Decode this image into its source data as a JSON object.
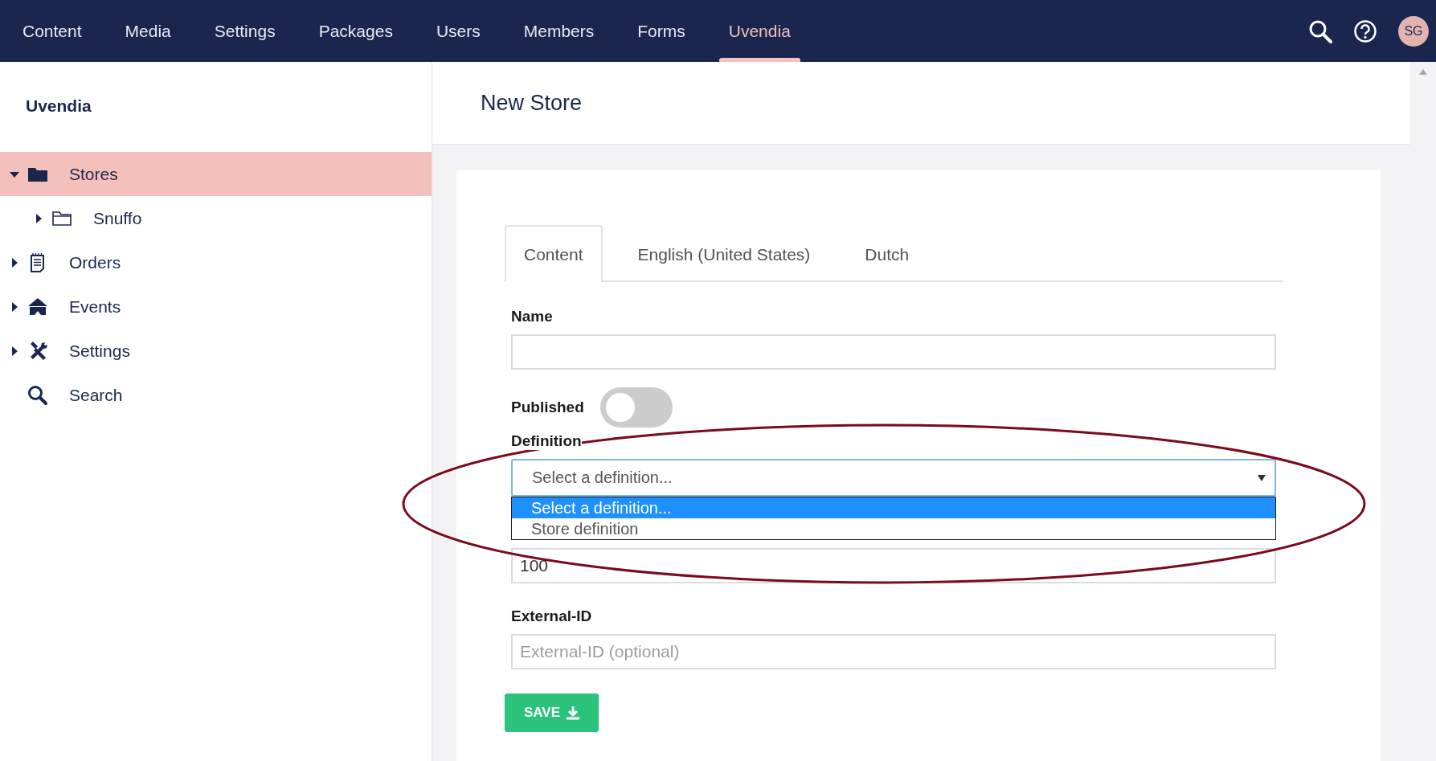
{
  "top_nav": {
    "items": [
      {
        "label": "Content",
        "selected": false
      },
      {
        "label": "Media",
        "selected": false
      },
      {
        "label": "Settings",
        "selected": false
      },
      {
        "label": "Packages",
        "selected": false
      },
      {
        "label": "Users",
        "selected": false
      },
      {
        "label": "Members",
        "selected": false
      },
      {
        "label": "Forms",
        "selected": false
      },
      {
        "label": "Uvendia",
        "selected": true
      }
    ],
    "avatar": "SG"
  },
  "sidebar": {
    "title": "Uvendia",
    "items": [
      {
        "label": "Stores",
        "selected": true,
        "expandable": true,
        "expanded": true,
        "children": [
          {
            "label": "Snuffo",
            "selected": false,
            "expandable": true,
            "expanded": false
          }
        ]
      },
      {
        "label": "Orders",
        "selected": false,
        "expandable": true,
        "expanded": false
      },
      {
        "label": "Events",
        "selected": false,
        "expandable": true,
        "expanded": false
      },
      {
        "label": "Settings",
        "selected": false,
        "expandable": true,
        "expanded": false
      },
      {
        "label": "Search",
        "selected": false,
        "expandable": false
      }
    ]
  },
  "editor": {
    "title": "New Store",
    "tabs": [
      {
        "label": "Content",
        "selected": true
      },
      {
        "label": "English (United States)",
        "selected": false
      },
      {
        "label": "Dutch",
        "selected": false
      }
    ],
    "fields": [
      {
        "kind": "text",
        "label": "Name"
      },
      {
        "kind": "toggle",
        "label": "Published",
        "on": false
      },
      {
        "kind": "select",
        "label": "Definition",
        "value": "Select a definition...",
        "open": true,
        "options": [
          {
            "label": "Select a definition...",
            "selected": true
          },
          {
            "label": "Store definition",
            "selected": false
          }
        ]
      },
      {
        "kind": "text",
        "value": "100"
      },
      {
        "kind": "text",
        "label": "External-ID",
        "placeholder": "External-ID (optional)"
      }
    ],
    "save_button": "SAVE"
  }
}
